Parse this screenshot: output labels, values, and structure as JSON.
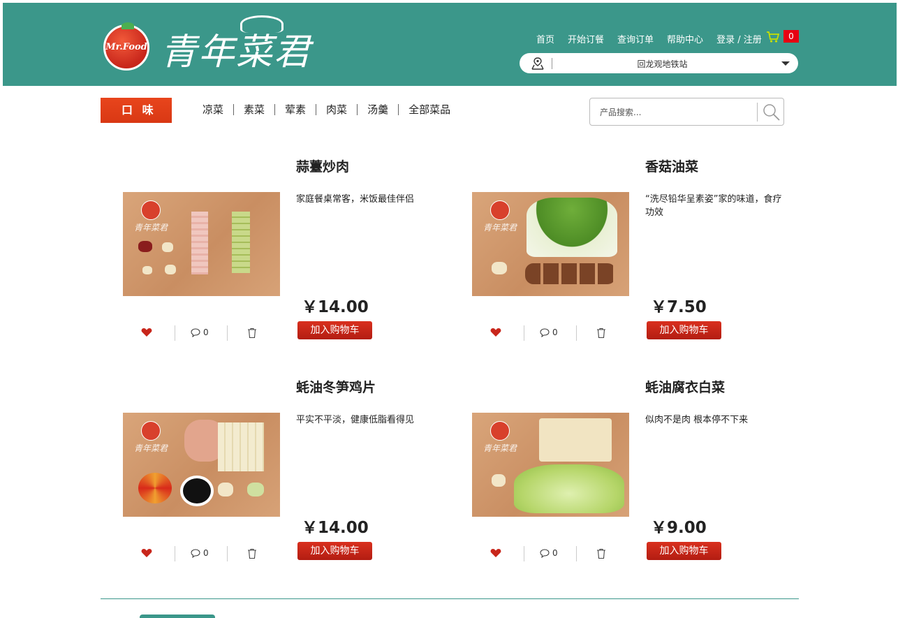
{
  "header": {
    "logo_text": "青年菜君",
    "logo_badge": "Mr.Food",
    "nav": [
      "首页",
      "开始订餐",
      "查询订单",
      "帮助中心",
      "登录 / 注册"
    ],
    "cart_count": "0",
    "location": "回龙观地铁站",
    "colors": {
      "header_bg": "#3b978a",
      "cart_badge": "#e60012"
    }
  },
  "filter": {
    "taste_label": "口 味",
    "categories": [
      "凉菜",
      "素菜",
      "荤素",
      "肉菜",
      "汤羹",
      "全部菜品"
    ],
    "search_placeholder": "产品搜索..."
  },
  "products": [
    {
      "title": "蒜薹炒肉",
      "desc": "家庭餐桌常客，米饭最佳伴侣",
      "price": "￥14.00",
      "comments": "0",
      "add_label": "加入购物车",
      "watermark": "青年菜君"
    },
    {
      "title": "香菇油菜",
      "desc": "“洗尽铅华呈素姿”家的味道，食疗功效",
      "price": "￥7.50",
      "comments": "0",
      "add_label": "加入购物车",
      "watermark": "青年菜君"
    },
    {
      "title": "蚝油冬笋鸡片",
      "desc": "平实不平淡，健康低脂看得见",
      "price": "￥14.00",
      "comments": "0",
      "add_label": "加入购物车",
      "watermark": "青年菜君"
    },
    {
      "title": "蚝油腐衣白菜",
      "desc": "似肉不是肉 根本停不下来",
      "price": "￥9.00",
      "comments": "0",
      "add_label": "加入购物车",
      "watermark": "青年菜君"
    }
  ]
}
